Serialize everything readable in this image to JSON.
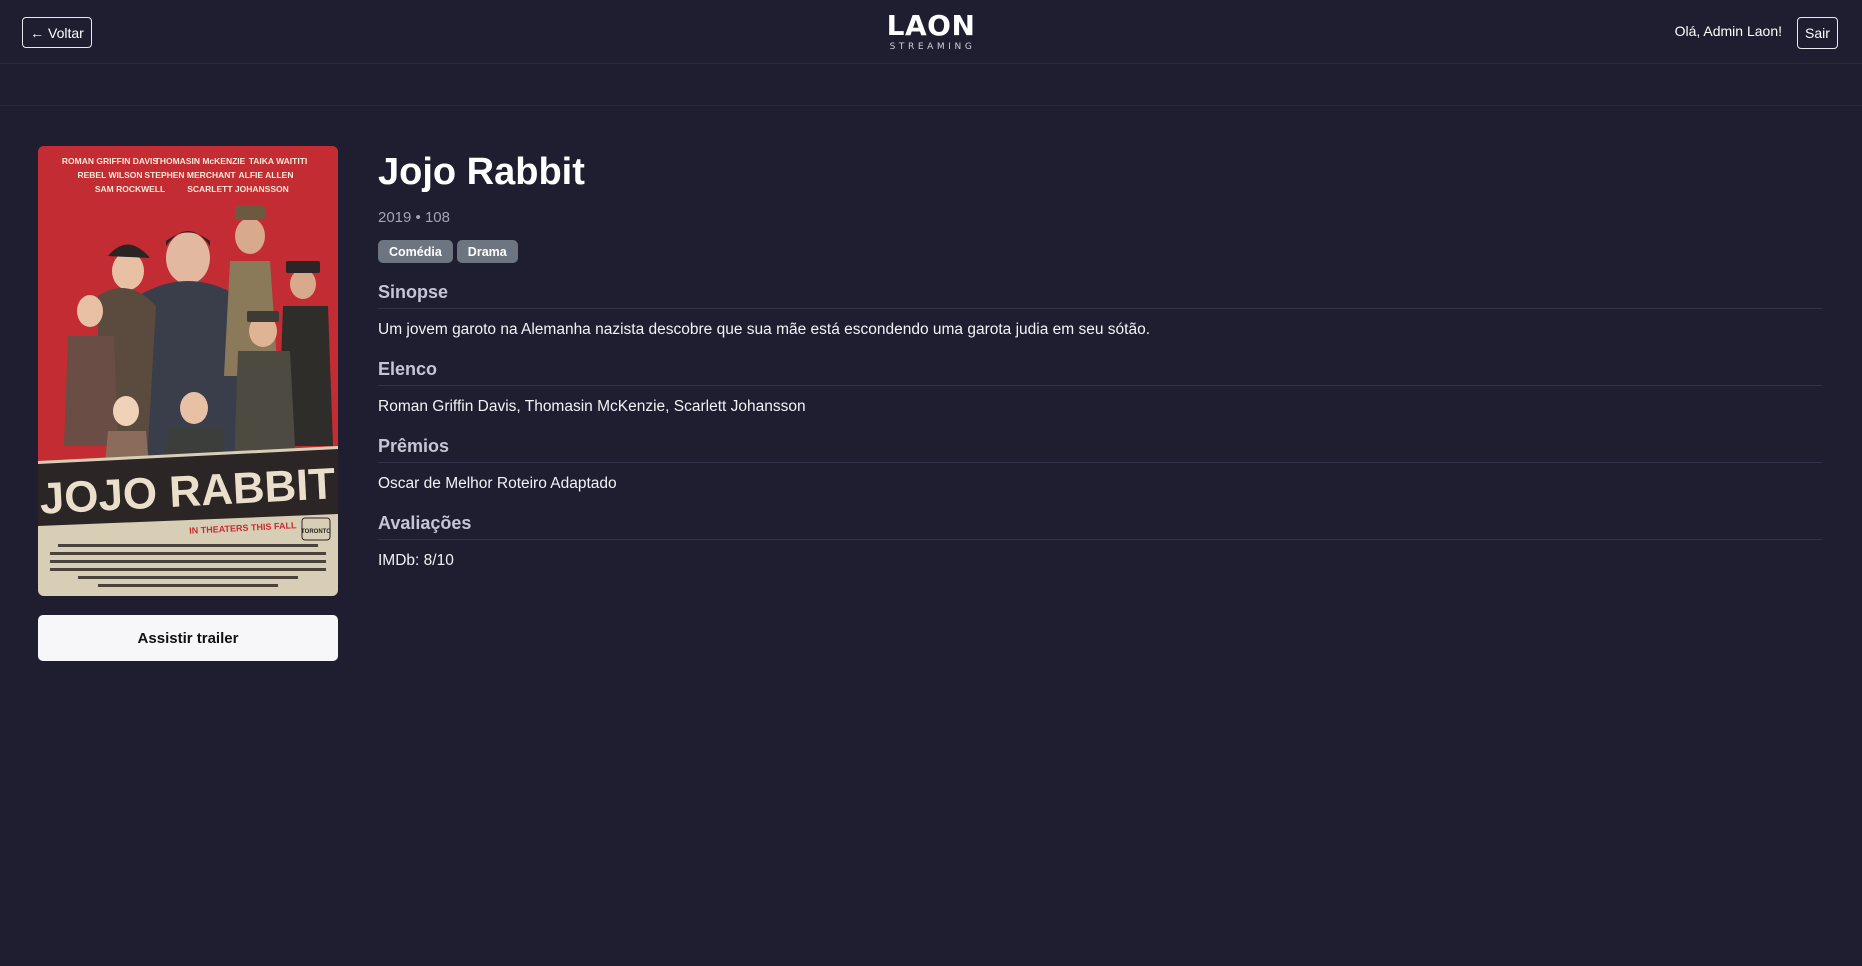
{
  "header": {
    "back_label": "← Voltar",
    "brand_name": "LAON",
    "brand_sub": "STREAMING",
    "greeting": "Olá, Admin Laon!",
    "logout_label": "Sair"
  },
  "poster": {
    "alt": "Jojo Rabbit",
    "title_art": "JOJO RABBIT",
    "tagline": "IN THEATERS THIS FALL",
    "credits_line1": [
      "ROMAN GRIFFIN DAVIS",
      "THOMASIN McKENZIE",
      "TAIKA WAITITI"
    ],
    "credits_line2": [
      "REBEL WILSON",
      "STEPHEN MERCHANT",
      "ALFIE ALLEN"
    ],
    "credits_line3": [
      "SAM ROCKWELL",
      "SCARLETT JOHANSSON"
    ],
    "festival_badge": "TORONTO",
    "colors": {
      "red": "#c92d34",
      "dark": "#2b2625",
      "paper": "#d8cdb5"
    }
  },
  "trailer_label": "Assistir trailer",
  "movie": {
    "title": "Jojo Rabbit",
    "meta": "2019 • 108",
    "tags": [
      "Comédia",
      "Drama"
    ]
  },
  "sections": {
    "synopsis": {
      "title": "Sinopse",
      "text": "Um jovem garoto na Alemanha nazista descobre que sua mãe está escondendo uma garota judia em seu sótão."
    },
    "cast": {
      "title": "Elenco",
      "text": "Roman Griffin Davis, Thomasin McKenzie, Scarlett Johansson"
    },
    "awards": {
      "title": "Prêmios",
      "text": "Oscar de Melhor Roteiro Adaptado"
    },
    "ratings": {
      "title": "Avaliações",
      "text": "IMDb: 8/10"
    }
  },
  "colors": {
    "background": "#1f1d30",
    "divider": "#2a2840",
    "tag": "#6c7580",
    "button_light": "#f7f7f9"
  }
}
